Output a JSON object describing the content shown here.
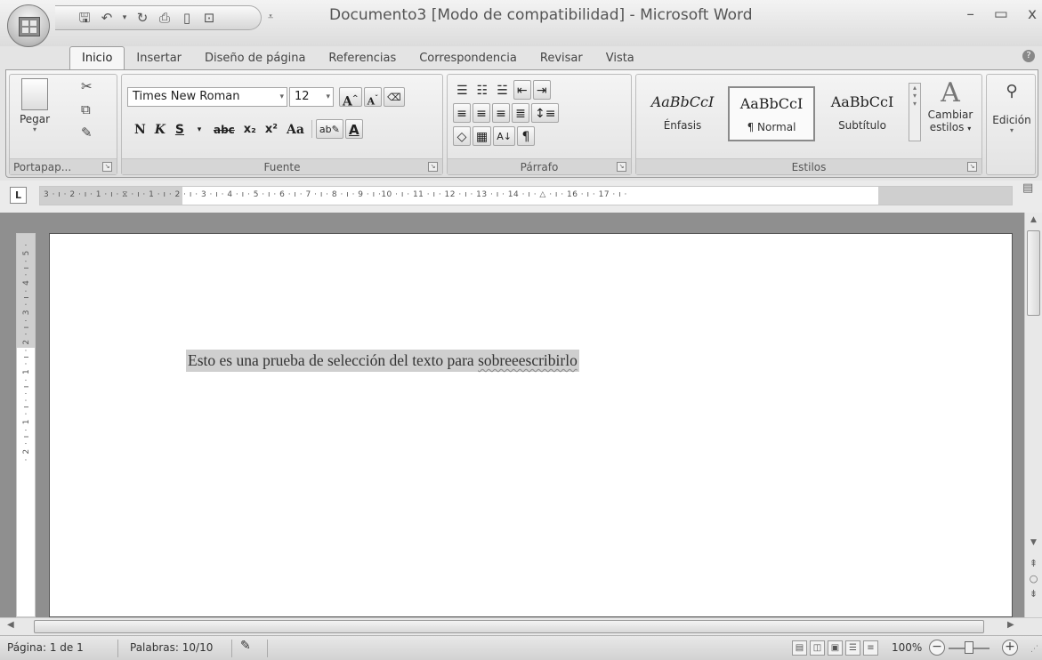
{
  "window": {
    "title": "Documento3 [Modo de compatibilidad] - Microsoft Word",
    "minimize": "–",
    "maximize": "▭",
    "close": "x"
  },
  "tabs": [
    "Inicio",
    "Insertar",
    "Diseño de página",
    "Referencias",
    "Correspondencia",
    "Revisar",
    "Vista"
  ],
  "active_tab": "Inicio",
  "ribbon": {
    "clipboard": {
      "label": "Portapap...",
      "paste": "Pegar"
    },
    "font": {
      "label": "Fuente",
      "family": "Times New Roman",
      "size": "12",
      "bold": "N",
      "italic": "K",
      "underline": "S",
      "strikethrough": "abc",
      "subscript": "x₂",
      "superscript": "x²",
      "change_case": "Aa",
      "grow": "A",
      "shrink": "A"
    },
    "paragraph": {
      "label": "Párrafo",
      "show_marks": "¶"
    },
    "styles": {
      "label": "Estilos",
      "items": [
        {
          "sample": "AaBbCcI",
          "name": "Énfasis"
        },
        {
          "sample": "AaBbCcI",
          "name": "¶ Normal"
        },
        {
          "sample": "AaBbCcI",
          "name": "Subtítulo"
        }
      ],
      "change_styles_line1": "Cambiar",
      "change_styles_line2": "estilos"
    },
    "editing": {
      "label": "Edición"
    }
  },
  "ruler": {
    "ticks": "3 · ı · 2 · ı · 1 · ı · ⧖ · ı · 1 · ı · 2 · ı · 3 · ı · 4 · ı · 5 · ı · 6 · ı · 7 · ı · 8 · ı · 9 · ı ·10 · ı · 11 · ı · 12 · ı · 13 · ı · 14 · ı · △ · ı · 16 · ı · 17 · ı ·",
    "vertical_ticks": "· 2 · ı · 1 · ı · · ı · 1 · ı · 2 · ı · 3 · ı · 4 · ı · 5 ·"
  },
  "document": {
    "text_before": "Esto es una prueba de selección del texto para ",
    "text_misspelled": "sobreeescribirlo"
  },
  "status": {
    "page": "Página: 1 de 1",
    "words": "Palabras: 10/10",
    "zoom": "100%"
  }
}
